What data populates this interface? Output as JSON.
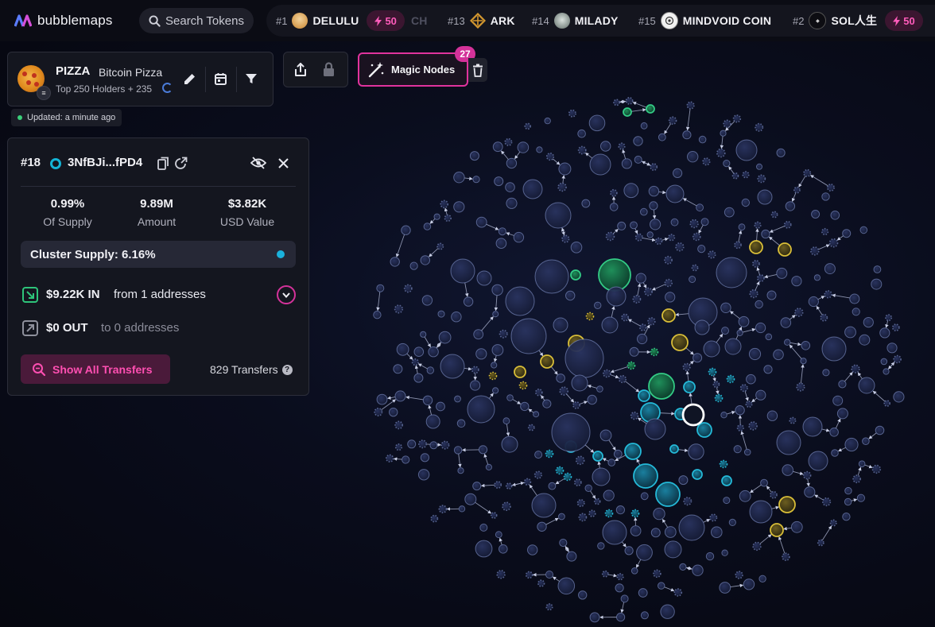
{
  "app": {
    "name": "bubblemaps"
  },
  "search": {
    "placeholder": "Search Tokens"
  },
  "trending": [
    {
      "rank": "#1",
      "name": "DELULU",
      "boost": "50",
      "icon_color": "#e7a84b"
    },
    {
      "rank": "",
      "name": "CH",
      "boost": "",
      "icon_color": ""
    },
    {
      "rank": "#13",
      "name": "ARK",
      "boost": "",
      "icon_color": "#d3972f"
    },
    {
      "rank": "#14",
      "name": "MILADY",
      "boost": "",
      "icon_color": "#9aa9a4"
    },
    {
      "rank": "#15",
      "name": "MINDVOID COIN",
      "boost": "",
      "icon_color": "#e6e6e6"
    },
    {
      "rank": "#2",
      "name": "SOL人生",
      "boost": "50",
      "icon_color": "#111111"
    }
  ],
  "token": {
    "symbol": "PIZZA",
    "name": "Bitcoin Pizza",
    "holders_label": "Top 250 Holders + 235",
    "updated": "Updated: a minute ago"
  },
  "magic_nodes": {
    "label": "Magic Nodes",
    "count": "27"
  },
  "wallet": {
    "rank": "#18",
    "address": "3NfBJi...fPD4",
    "stats": [
      {
        "value": "0.99%",
        "label": "Of Supply"
      },
      {
        "value": "9.89M",
        "label": "Amount"
      },
      {
        "value": "$3.82K",
        "label": "USD Value"
      }
    ],
    "cluster_supply": "Cluster Supply: 6.16%",
    "in_amount": "$9.22K IN",
    "in_from": "from 1 addresses",
    "out_amount": "$0 OUT",
    "out_to": "to 0 addresses",
    "show_transfers": "Show All Transfers",
    "transfers_count": "829 Transfers"
  },
  "colors": {
    "accent_pink": "#e0339d",
    "cluster_cyan": "#1ab1dc",
    "cluster_green": "#2bd08a",
    "cluster_yellow": "#e3c63a",
    "bubble_default": "#6a7bb0"
  },
  "bubble_map": {
    "bubble_count": 250,
    "selected_wallet_rank": "#18"
  }
}
